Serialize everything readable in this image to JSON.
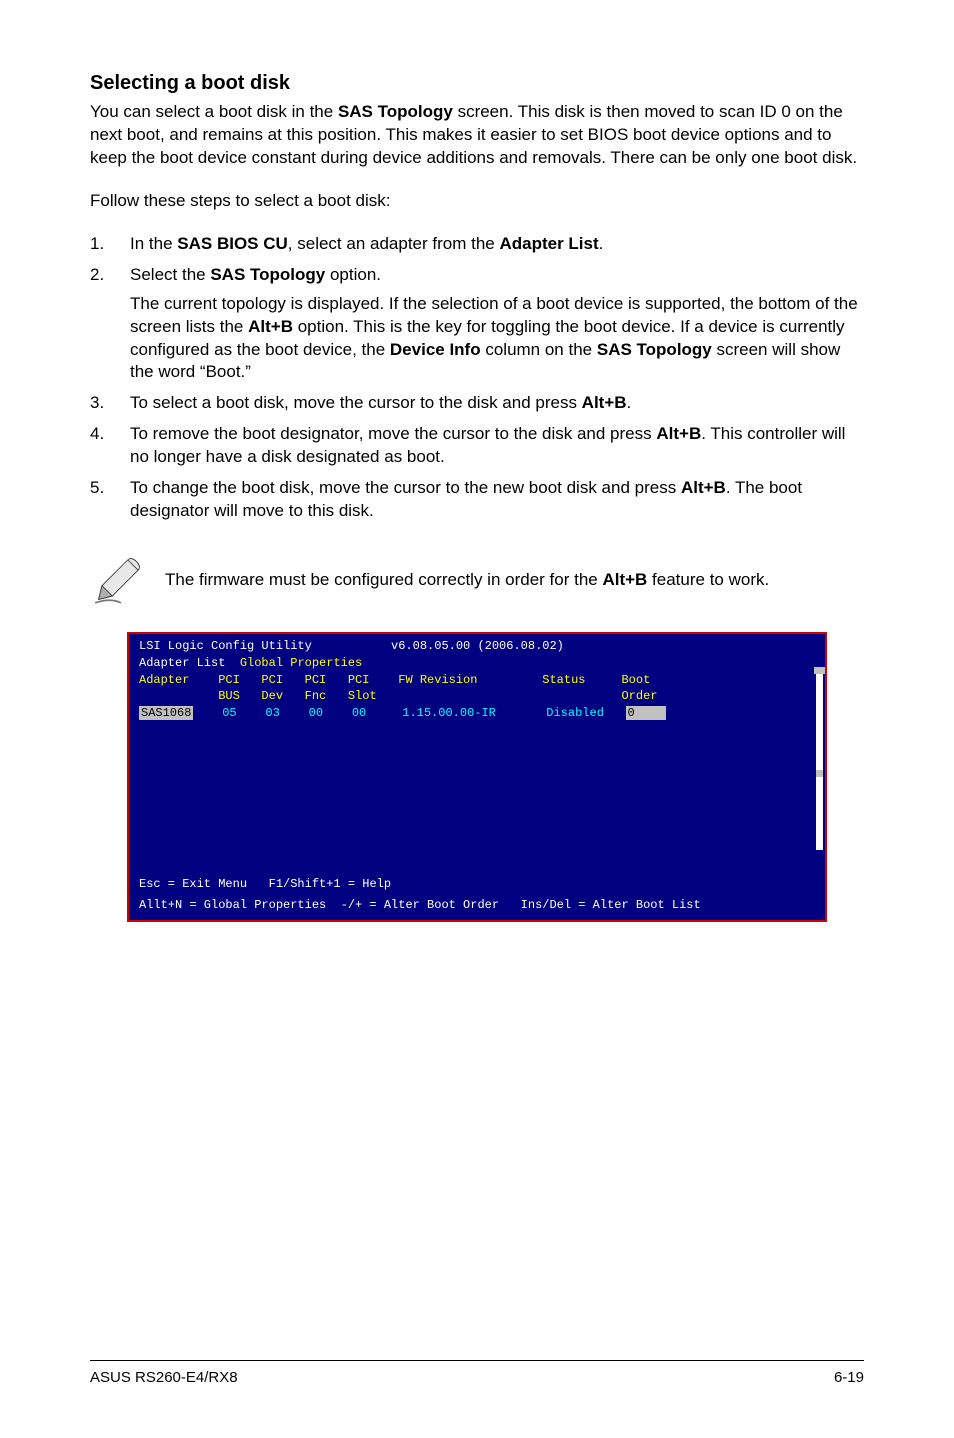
{
  "heading": "Selecting a boot disk",
  "introParts": [
    "You can select a boot disk in the ",
    "SAS Topology",
    " screen. This disk is then moved to scan ID 0 on the next boot, and remains at this position. This makes it easier to set BIOS boot device options and to keep the boot device constant during device additions and removals. There can be only one boot disk."
  ],
  "follow": "Follow these steps to select a boot disk:",
  "steps": [
    {
      "num": "1.",
      "parts": [
        "In the ",
        "SAS BIOS CU",
        ", select an adapter from the ",
        "Adapter List",
        "."
      ]
    },
    {
      "num": "2.",
      "parts": [
        "Select the ",
        "SAS Topology",
        " option."
      ],
      "subParts": [
        "The current topology is displayed. If the selection of a boot device is supported, the bottom of the screen lists the ",
        "Alt+B",
        " option. This is the key for toggling the boot device. If a device is currently configured as the boot device, the ",
        "Device Info",
        " column on the ",
        "SAS Topology",
        " screen will show the word “Boot.”"
      ]
    },
    {
      "num": "3.",
      "parts": [
        "To select a boot disk, move the cursor to the disk and press ",
        "Alt+B",
        "."
      ]
    },
    {
      "num": "4.",
      "parts": [
        "To remove the boot designator, move the cursor to the disk and press ",
        "Alt+B",
        ". This controller will no longer have a disk designated as boot."
      ]
    },
    {
      "num": "5.",
      "parts": [
        "To change the boot disk, move the cursor to the new boot disk and press ",
        "Alt+B",
        ". The boot designator will move to this disk."
      ]
    }
  ],
  "noteParts": [
    "The firmware must be configured correctly in order for the ",
    "Alt+B",
    " feature to work."
  ],
  "bios": {
    "title": "LSI Logic Config Utility           v6.08.05.00 (2006.08.02)",
    "menu": {
      "m1": "Adapter List  ",
      "m2": "Global Properties"
    },
    "header1": "Adapter    PCI   PCI   PCI   PCI    FW Revision         Status     Boot",
    "header2": "           BUS   Dev   Fnc   Slot                                  Order",
    "row": {
      "adapter": "SAS1068",
      "mid": "    05    03    00    00     1.15.00.00-IR       Disabled   ",
      "boot": "0    "
    },
    "footer1": "Esc = Exit Menu   F1/Shift+1 = Help",
    "footer2": "Allt+N = Global Properties  -/+ = Alter Boot Order   Ins/Del = Alter Boot List"
  },
  "footer": {
    "left": "ASUS RS260-E4/RX8",
    "right": "6-19"
  }
}
